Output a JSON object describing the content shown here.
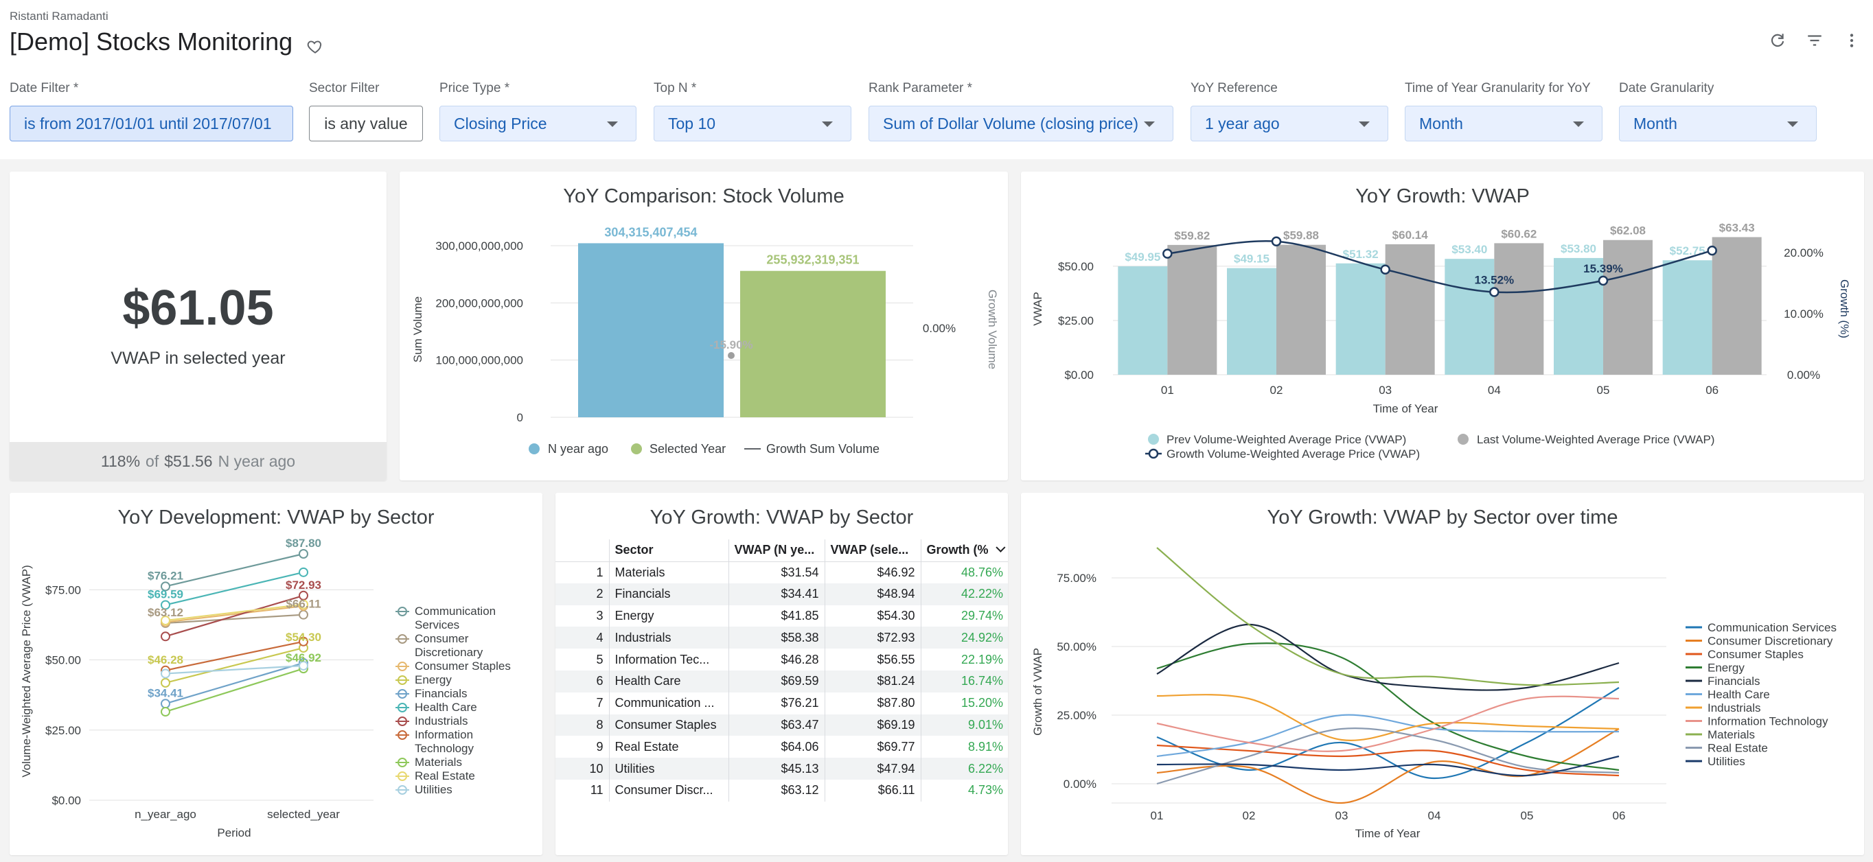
{
  "header": {
    "author": "Ristanti Ramadanti",
    "title": "[Demo] Stocks Monitoring"
  },
  "filters": [
    {
      "label": "Date Filter *",
      "value": "is from 2017/01/01 until 2017/07/01"
    },
    {
      "label": "Sector Filter",
      "value": "is any value"
    },
    {
      "label": "Price Type *",
      "value": "Closing Price"
    },
    {
      "label": "Top N *",
      "value": "Top 10"
    },
    {
      "label": "Rank Parameter *",
      "value": "Sum of Dollar Volume (closing price)"
    },
    {
      "label": "YoY Reference",
      "value": "1 year ago"
    },
    {
      "label": "Time of Year Granularity for YoY",
      "value": "Month"
    },
    {
      "label": "Date Granularity",
      "value": "Month"
    }
  ],
  "kpi": {
    "value": "$61.05",
    "label": "VWAP in selected year",
    "comparison_pct": "118%",
    "comparison_of": "of",
    "comparison_value": "$51.56",
    "comparison_suffix": "N year ago"
  },
  "volume_chart": {
    "title": "YoY Comparison: Stock Volume",
    "chart_data": {
      "type": "bar",
      "categories": [
        "N year ago",
        "Selected Year"
      ],
      "values": [
        304315407454,
        255932319351
      ],
      "value_labels": [
        "304,315,407,454",
        "255,932,319,351"
      ],
      "growth_label": "-15.90%",
      "growth_value": -15.9,
      "ylabel": "Sum Volume",
      "y2label": "Growth Volume",
      "ylim": [
        0,
        300000000000
      ],
      "yticks": [
        "0",
        "100,000,000,000",
        "200,000,000,000",
        "300,000,000,000"
      ],
      "y2ticks": [
        "0.00%"
      ],
      "colors": [
        "#79b8d4",
        "#a8c57a"
      ],
      "legend": [
        "N year ago",
        "Selected Year",
        "Growth Sum Volume"
      ]
    }
  },
  "vwap_growth_chart": {
    "title": "YoY Growth: VWAP",
    "chart_data": {
      "type": "bar",
      "categories": [
        "01",
        "02",
        "03",
        "04",
        "05",
        "06"
      ],
      "series": [
        {
          "name": "Prev Volume-Weighted Average Price (VWAP)",
          "values": [
            49.95,
            49.15,
            51.32,
            53.4,
            53.8,
            52.75
          ],
          "labels": [
            "$49.95",
            "$49.15",
            "$51.32",
            "$53.40",
            "$53.80",
            "$52.75"
          ],
          "color": "#a8d8de"
        },
        {
          "name": "Last Volume-Weighted Average Price (VWAP)",
          "values": [
            59.82,
            59.88,
            60.14,
            60.62,
            62.08,
            63.43
          ],
          "labels": [
            "$59.82",
            "$59.88",
            "$60.14",
            "$60.62",
            "$62.08",
            "$63.43"
          ],
          "color": "#b0b0b0"
        },
        {
          "name": "Growth Volume-Weighted Average Price (VWAP)",
          "values": [
            19.8,
            21.8,
            17.2,
            13.52,
            15.39,
            20.3
          ],
          "labels": [
            "",
            "",
            "",
            "13.52%",
            "15.39%",
            ""
          ],
          "color": "#1e3a5f"
        }
      ],
      "xlabel": "Time of Year",
      "ylabel": "VWAP",
      "y2label": "Growth (%)",
      "ylim": [
        0,
        62
      ],
      "y2lim": [
        0,
        22
      ],
      "yticks": [
        "$0.00",
        "$25.00",
        "$50.00"
      ],
      "y2ticks": [
        "0.00%",
        "10.00%",
        "20.00%"
      ]
    }
  },
  "sector_dev_chart": {
    "title": "YoY Development: VWAP by Sector",
    "chart_data": {
      "type": "line",
      "x": [
        "n_year_ago",
        "selected_year"
      ],
      "xlabel": "Period",
      "ylabel": "Volume-Weighted Average Price (VWAP)",
      "ylim": [
        0,
        90
      ],
      "yticks": [
        "$0.00",
        "$25.00",
        "$50.00",
        "$75.00"
      ],
      "series": [
        {
          "name": "Communication Services",
          "values": [
            76.21,
            87.8
          ],
          "color": "#6e9a9a"
        },
        {
          "name": "Consumer Discretionary",
          "values": [
            63.12,
            66.11
          ],
          "color": "#a89a82"
        },
        {
          "name": "Consumer Staples",
          "values": [
            63.47,
            69.19
          ],
          "color": "#e6b86e"
        },
        {
          "name": "Energy",
          "values": [
            41.85,
            54.3
          ],
          "color": "#c8c850"
        },
        {
          "name": "Financials",
          "values": [
            34.41,
            48.94
          ],
          "color": "#6fa2c8"
        },
        {
          "name": "Health Care",
          "values": [
            69.59,
            81.24
          ],
          "color": "#4ab5b5"
        },
        {
          "name": "Industrials",
          "values": [
            58.38,
            72.93
          ],
          "color": "#a84d4d"
        },
        {
          "name": "Information Technology",
          "values": [
            46.28,
            56.55
          ],
          "color": "#c86a3a"
        },
        {
          "name": "Materials",
          "values": [
            31.54,
            46.92
          ],
          "color": "#8ec85a"
        },
        {
          "name": "Real Estate",
          "values": [
            64.06,
            69.77
          ],
          "color": "#e8d870"
        },
        {
          "name": "Utilities",
          "values": [
            45.13,
            47.94
          ],
          "color": "#a8d0e0"
        }
      ],
      "point_labels": [
        {
          "text": "$76.21",
          "color": "#6e9a9a"
        },
        {
          "text": "$69.59",
          "color": "#4ab5b5"
        },
        {
          "text": "$63.12",
          "color": "#a89a82"
        },
        {
          "text": "$46.28",
          "color": "#c8c850"
        },
        {
          "text": "$34.41",
          "color": "#6fa2c8"
        },
        {
          "text": "$87.80",
          "color": "#6e9a9a"
        },
        {
          "text": "$72.93",
          "color": "#a84d4d"
        },
        {
          "text": "$66.11",
          "color": "#a89a82"
        },
        {
          "text": "$54.30",
          "color": "#c8c850"
        },
        {
          "text": "$46.92",
          "color": "#8ec85a"
        }
      ],
      "legend": [
        "Communication Services",
        "Consumer Discretionary",
        "Consumer Staples",
        "Energy",
        "Financials",
        "Health Care",
        "Industrials",
        "Information Technology",
        "Materials",
        "Real Estate",
        "Utilities"
      ]
    }
  },
  "sector_table": {
    "title": "YoY Growth: VWAP by Sector",
    "columns": [
      "Sector",
      "VWAP (N ye...",
      "VWAP (sele...",
      "Growth (%"
    ],
    "rows": [
      [
        "1",
        "Materials",
        "$31.54",
        "$46.92",
        "48.76%"
      ],
      [
        "2",
        "Financials",
        "$34.41",
        "$48.94",
        "42.22%"
      ],
      [
        "3",
        "Energy",
        "$41.85",
        "$54.30",
        "29.74%"
      ],
      [
        "4",
        "Industrials",
        "$58.38",
        "$72.93",
        "24.92%"
      ],
      [
        "5",
        "Information Tec...",
        "$46.28",
        "$56.55",
        "22.19%"
      ],
      [
        "6",
        "Health Care",
        "$69.59",
        "$81.24",
        "16.74%"
      ],
      [
        "7",
        "Communication ...",
        "$76.21",
        "$87.80",
        "15.20%"
      ],
      [
        "8",
        "Consumer Staples",
        "$63.47",
        "$69.19",
        "9.01%"
      ],
      [
        "9",
        "Real Estate",
        "$64.06",
        "$69.77",
        "8.91%"
      ],
      [
        "10",
        "Utilities",
        "$45.13",
        "$47.94",
        "6.22%"
      ],
      [
        "11",
        "Consumer Discr...",
        "$63.12",
        "$66.11",
        "4.73%"
      ]
    ]
  },
  "sector_time_chart": {
    "title": "YoY Growth: VWAP by Sector over time",
    "chart_data": {
      "type": "line",
      "x": [
        "01",
        "02",
        "03",
        "04",
        "05",
        "06"
      ],
      "xlabel": "Time of Year",
      "ylabel": "Growth of VWAP",
      "ylim": [
        -7,
        86
      ],
      "yticks": [
        "0.00%",
        "25.00%",
        "50.00%",
        "75.00%"
      ],
      "series": [
        {
          "name": "Communication Services",
          "values": [
            17,
            5,
            15,
            2,
            15,
            35
          ],
          "color": "#1f77b4"
        },
        {
          "name": "Consumer Discretionary",
          "values": [
            4,
            6,
            -7,
            8,
            3,
            20
          ],
          "color": "#e67e22"
        },
        {
          "name": "Consumer Staples",
          "values": [
            14,
            12,
            10,
            12,
            5,
            3
          ],
          "color": "#e0571b"
        },
        {
          "name": "Energy",
          "values": [
            42,
            51,
            46,
            22,
            10,
            5
          ],
          "color": "#2e7d32"
        },
        {
          "name": "Financials",
          "values": [
            40,
            58,
            40,
            35,
            35,
            44
          ],
          "color": "#1b2a41"
        },
        {
          "name": "Health Care",
          "values": [
            10,
            15,
            25,
            20,
            19,
            19
          ],
          "color": "#6fa8dc"
        },
        {
          "name": "Industrials",
          "values": [
            32,
            31,
            16,
            22,
            21,
            20
          ],
          "color": "#f0a030"
        },
        {
          "name": "Information Technology",
          "values": [
            22,
            15,
            12,
            20,
            31,
            31
          ],
          "color": "#e8928a"
        },
        {
          "name": "Materials",
          "values": [
            86,
            58,
            40,
            39,
            36,
            37
          ],
          "color": "#8bb050"
        },
        {
          "name": "Real Estate",
          "values": [
            0,
            10,
            20,
            16,
            6,
            4
          ],
          "color": "#8a9ab0"
        },
        {
          "name": "Utilities",
          "values": [
            7,
            7,
            5,
            7,
            3,
            10
          ],
          "color": "#1a3a6a"
        }
      ],
      "legend": [
        "Communication Services",
        "Consumer Discretionary",
        "Consumer Staples",
        "Energy",
        "Financials",
        "Health Care",
        "Industrials",
        "Information Technology",
        "Materials",
        "Real Estate",
        "Utilities"
      ]
    }
  }
}
